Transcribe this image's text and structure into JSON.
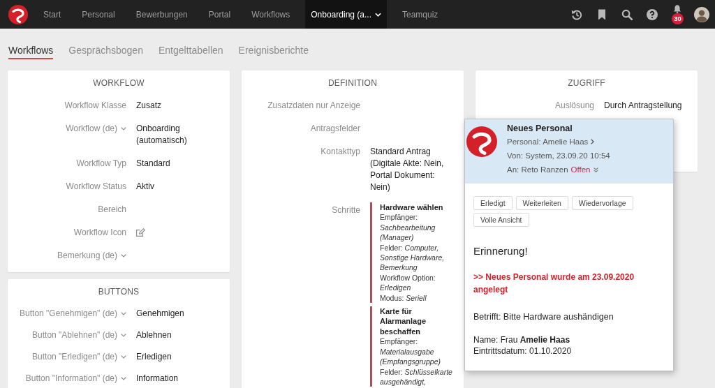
{
  "nav": {
    "items": [
      {
        "label": "Start",
        "selected": false,
        "dropdown": false
      },
      {
        "label": "Personal",
        "selected": false,
        "dropdown": false
      },
      {
        "label": "Bewerbungen",
        "selected": false,
        "dropdown": false
      },
      {
        "label": "Portal",
        "selected": false,
        "dropdown": false
      },
      {
        "label": "Workflows",
        "selected": false,
        "dropdown": false
      },
      {
        "label": "Onboarding (a...",
        "selected": true,
        "dropdown": true
      },
      {
        "label": "Teamquiz",
        "selected": false,
        "dropdown": false
      }
    ]
  },
  "toolbar": {
    "notification_badge": "30"
  },
  "tabs": [
    {
      "label": "Workflows",
      "selected": true
    },
    {
      "label": "Gesprächsbogen",
      "selected": false
    },
    {
      "label": "Entgelttabellen",
      "selected": false
    },
    {
      "label": "Ereignisberichte",
      "selected": false
    }
  ],
  "workflow_card": {
    "title": "WORKFLOW",
    "rows": [
      {
        "label": "Workflow Klasse",
        "expandable": false,
        "kind": "text",
        "value": "Zusatz"
      },
      {
        "label": "Workflow (de)",
        "expandable": true,
        "kind": "text",
        "value": "Onboarding (automatisch)"
      },
      {
        "label": "Workflow Typ",
        "expandable": false,
        "kind": "text",
        "value": "Standard"
      },
      {
        "label": "Workflow Status",
        "expandable": false,
        "kind": "text",
        "value": "Aktiv"
      },
      {
        "label": "Bereich",
        "expandable": false,
        "kind": "text"
      },
      {
        "label": "Workflow Icon",
        "expandable": false,
        "kind": "icon"
      },
      {
        "label": "Bemerkung (de)",
        "expandable": true,
        "kind": "text"
      }
    ]
  },
  "buttons_card": {
    "title": "BUTTONS",
    "rows": [
      {
        "label": "Button \"Genehmigen\" (de)",
        "expandable": true,
        "kind": "text",
        "value": "Genehmigen"
      },
      {
        "label": "Button \"Ablehnen\" (de)",
        "expandable": true,
        "kind": "text",
        "value": "Ablehnen"
      },
      {
        "label": "Button \"Erledigen\" (de)",
        "expandable": true,
        "kind": "text",
        "value": "Erledigen"
      },
      {
        "label": "Button \"Information\" (de)",
        "expandable": true,
        "kind": "text",
        "value": "Information"
      }
    ]
  },
  "definition_card": {
    "title": "DEFINITION",
    "rows": [
      {
        "label": "Zusatzdaten nur Anzeige",
        "expandable": false,
        "kind": "text"
      },
      {
        "label": "Antragsfelder",
        "expandable": false,
        "kind": "text"
      },
      {
        "label": "Kontakttyp",
        "expandable": false,
        "kind": "text",
        "value": "Standard Antrag (Digitale Akte: Nein, Portal Dokument: Nein)"
      },
      {
        "label": "Schritte",
        "expandable": false,
        "kind": "steps",
        "steps": [
          {
            "title": "Hardware wählen",
            "lines": [
              "Empfänger: *Sachbearbeitung (Manager)*",
              "Felder: *Computer, Sonstige Hardware, Bemerkung*",
              "Workflow Option: *Erledigen*",
              "Modus: *Seriell*"
            ]
          },
          {
            "title": "Karte für Alarmanlage beschaffen",
            "lines": [
              "Empfänger: *Materialausgabe (Empfangsgruppe)*",
              "Felder: *Schlüsselkarte ausgehändigt,*"
            ]
          }
        ]
      }
    ]
  },
  "access_card": {
    "title": "ZUGRIFF",
    "rows": [
      {
        "label": "Auslösung",
        "expandable": false,
        "kind": "text",
        "value": "Durch Antragstellung"
      }
    ]
  },
  "notification": {
    "title": "Neues Personal",
    "personal_link": "Personal: Amelie Haas",
    "sender": "Von: System, 23.09.20 10:54",
    "recipient": "An: Reto Ranzen",
    "status": "Offen",
    "actions": [
      "Erledigt",
      "Weiterleiten",
      "Wiedervorlage",
      "Volle Ansicht"
    ],
    "heading": "Erinnerung!",
    "alert": ">> Neues Personal wurde am 23.09.2020 angelegt",
    "subject": "Betrifft: Bitte Hardware aushändigen",
    "details": [
      "Name: Frau **Amelie Haas**",
      "Eintrittsdatum: 01.10.2020"
    ]
  }
}
